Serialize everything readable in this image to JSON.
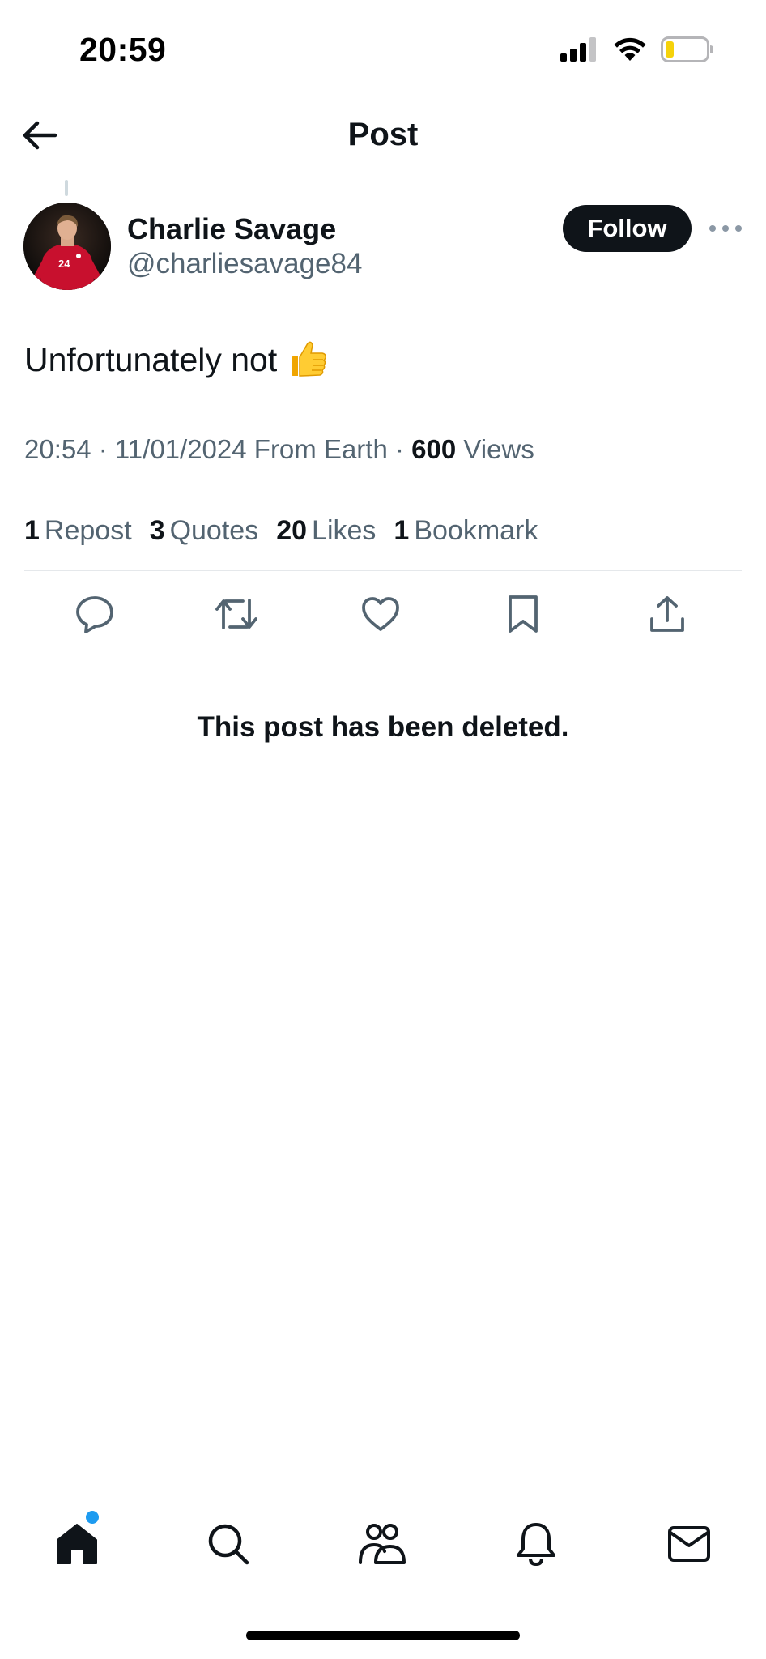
{
  "status_bar": {
    "time": "20:59"
  },
  "header": {
    "title": "Post"
  },
  "author": {
    "name": "Charlie Savage",
    "handle": "@charliesavage84",
    "follow_label": "Follow"
  },
  "post": {
    "text": "Unfortunately not",
    "emoji": "thumbs-up",
    "timestamp": "20:54 · 11/01/2024 From Earth",
    "views_count": "600",
    "views_label": "Views"
  },
  "stats": [
    {
      "count": "1",
      "label": "Repost"
    },
    {
      "count": "3",
      "label": "Quotes"
    },
    {
      "count": "20",
      "label": "Likes"
    },
    {
      "count": "1",
      "label": "Bookmark"
    }
  ],
  "deleted_notice": "This post has been deleted.",
  "nav": {
    "items": [
      "home-icon",
      "search-icon",
      "communities-icon",
      "notifications-icon",
      "messages-icon"
    ],
    "active": "home-icon"
  },
  "colors": {
    "accent": "#1d9bf0",
    "text": "#0f1419",
    "secondary": "#536471"
  }
}
